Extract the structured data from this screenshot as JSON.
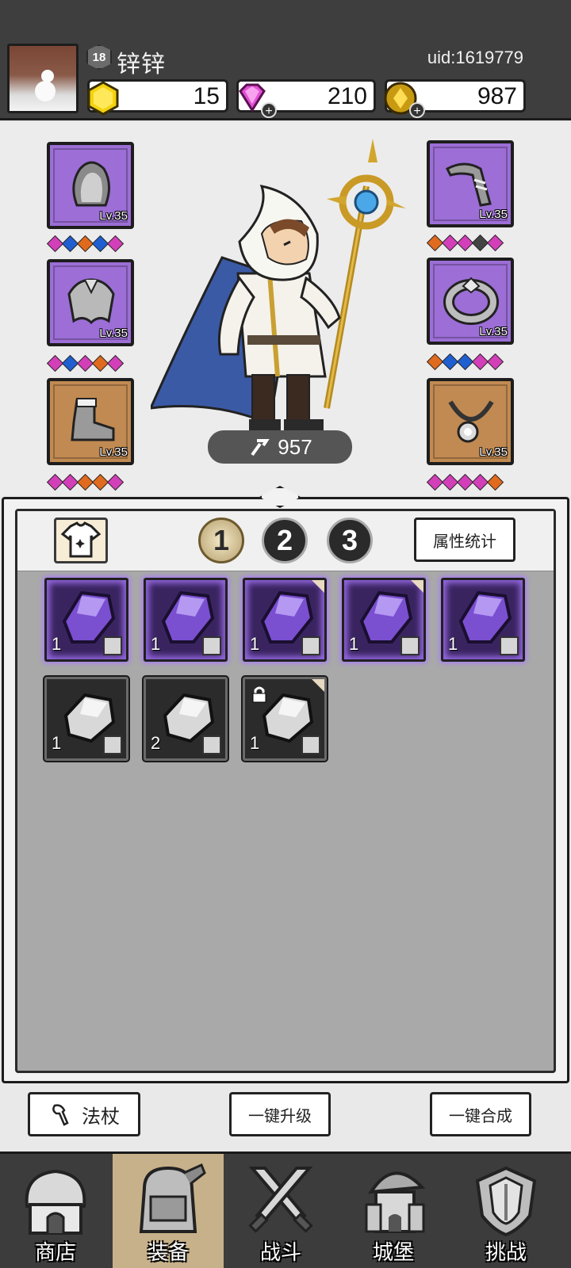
{
  "header": {
    "player_level": "18",
    "player_name": "锌锌",
    "uid": "uid:1619779",
    "resources": [
      {
        "name": "yellow-gem",
        "value": "15",
        "icon": "yellow-hexagon-gem-icon"
      },
      {
        "name": "diamond",
        "value": "210",
        "icon": "pink-diamond-icon"
      },
      {
        "name": "gold",
        "value": "987",
        "icon": "gold-coin-icon"
      }
    ]
  },
  "equipment": {
    "slots": [
      {
        "name": "helmet",
        "level": "Lv.35",
        "rarity": "purple",
        "gems": [
          "#d23fb8",
          "#1f5fd0",
          "#e06a1e",
          "#1f5fd0",
          "#d23fb8"
        ]
      },
      {
        "name": "armor",
        "level": "Lv.35",
        "rarity": "purple",
        "gems": [
          "#d23fb8",
          "#1f5fd0",
          "#d23fb8",
          "#e06a1e",
          "#d23fb8"
        ]
      },
      {
        "name": "boots",
        "level": "Lv.35",
        "rarity": "orange",
        "gems": [
          "#d23fb8",
          "#d23fb8",
          "#e06a1e",
          "#e06a1e",
          "#d23fb8"
        ]
      },
      {
        "name": "weapon",
        "level": "Lv.35",
        "rarity": "purple",
        "gems": [
          "#e06a1e",
          "#d23fb8",
          "#d23fb8",
          "#444444",
          "#d23fb8"
        ]
      },
      {
        "name": "ring",
        "level": "Lv.35",
        "rarity": "purple",
        "gems": [
          "#e06a1e",
          "#1f5fd0",
          "#1f5fd0",
          "#d23fb8",
          "#d23fb8"
        ]
      },
      {
        "name": "necklace",
        "level": "Lv.35",
        "rarity": "orange",
        "gems": [
          "#d23fb8",
          "#d23fb8",
          "#d23fb8",
          "#d23fb8",
          "#e06a1e"
        ]
      }
    ],
    "power": "957"
  },
  "inventory": {
    "loadouts": [
      "1",
      "2",
      "3"
    ],
    "active_loadout": "1",
    "stats_button": "属性统计",
    "items": [
      {
        "rarity": "purple",
        "count": "1"
      },
      {
        "rarity": "purple",
        "count": "1"
      },
      {
        "rarity": "purple",
        "count": "1"
      },
      {
        "rarity": "purple",
        "count": "1"
      },
      {
        "rarity": "purple",
        "count": "1"
      },
      {
        "rarity": "grey",
        "count": "1"
      },
      {
        "rarity": "grey",
        "count": "2"
      },
      {
        "rarity": "grey",
        "count": "1",
        "locked": true
      }
    ]
  },
  "actions": {
    "filter_label": "法杖",
    "upgrade_label": "一键升级",
    "merge_label": "一键合成"
  },
  "nav": {
    "items": [
      {
        "label": "商店",
        "icon": "shop-hut-icon"
      },
      {
        "label": "装备",
        "icon": "backpack-icon"
      },
      {
        "label": "战斗",
        "icon": "crossed-swords-icon"
      },
      {
        "label": "城堡",
        "icon": "castle-tower-icon"
      },
      {
        "label": "挑战",
        "icon": "shield-crest-icon"
      }
    ],
    "active_index": 1
  }
}
